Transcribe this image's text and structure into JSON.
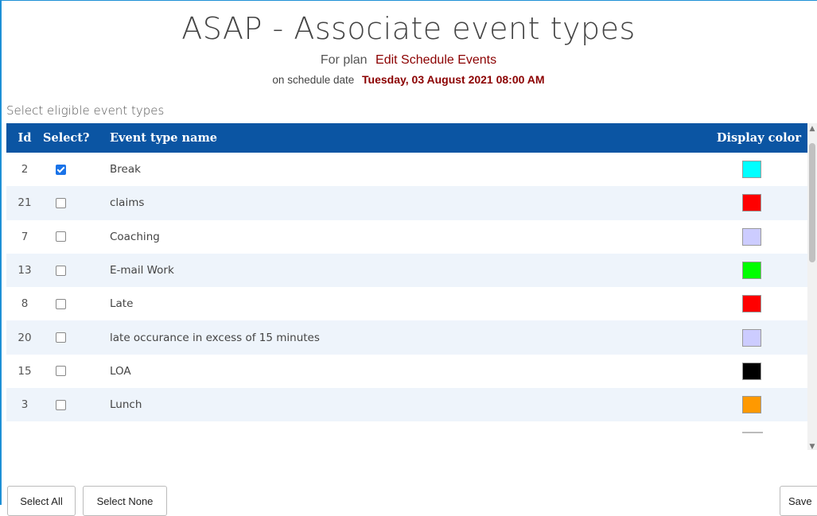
{
  "header": {
    "title": "ASAP - Associate event types",
    "plan_prefix": "For plan",
    "plan_name": "Edit Schedule Events",
    "date_prefix": "on schedule date",
    "schedule_date": "Tuesday, 03 August 2021 08:00 AM"
  },
  "section_label": "Select eligible event types",
  "table": {
    "columns": [
      "Id",
      "Select?",
      "Event type name",
      "Display color"
    ],
    "rows": [
      {
        "id": "2",
        "selected": true,
        "name": "Break",
        "color": "#00ffff"
      },
      {
        "id": "21",
        "selected": false,
        "name": "claims",
        "color": "#ff0000"
      },
      {
        "id": "7",
        "selected": false,
        "name": "Coaching",
        "color": "#ccccff"
      },
      {
        "id": "13",
        "selected": false,
        "name": "E-mail Work",
        "color": "#00ff00"
      },
      {
        "id": "8",
        "selected": false,
        "name": "Late",
        "color": "#ff0000"
      },
      {
        "id": "20",
        "selected": false,
        "name": "late occurance in excess of 15 minutes",
        "color": "#ccccff"
      },
      {
        "id": "15",
        "selected": false,
        "name": "LOA",
        "color": "#000000"
      },
      {
        "id": "3",
        "selected": false,
        "name": "Lunch",
        "color": "#ff9900"
      }
    ]
  },
  "buttons": {
    "select_all": "Select All",
    "select_none": "Select None",
    "save": "Save"
  },
  "colors": {
    "header_bg": "#0b55a3",
    "accent_text": "#8b0000",
    "frame_border": "#1e90d6"
  }
}
